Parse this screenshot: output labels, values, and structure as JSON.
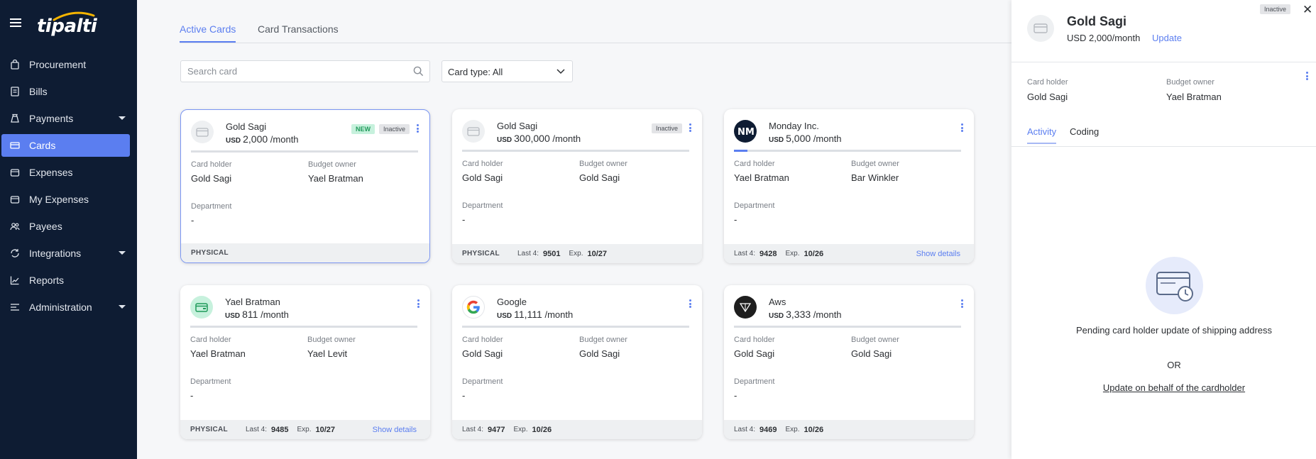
{
  "app": {
    "logo_text": "tipalti",
    "nav": [
      {
        "label": "Procurement",
        "icon": "shopping-bag-icon",
        "active": false,
        "has_caret": false
      },
      {
        "label": "Bills",
        "icon": "document-icon",
        "active": false,
        "has_caret": false
      },
      {
        "label": "Payments",
        "icon": "money-bag-icon",
        "active": false,
        "has_caret": true
      },
      {
        "label": "Cards",
        "icon": "credit-card-icon",
        "active": true,
        "has_caret": false
      },
      {
        "label": "Expenses",
        "icon": "wallet-icon",
        "active": false,
        "has_caret": false
      },
      {
        "label": "My Expenses",
        "icon": "wallet-icon",
        "active": false,
        "has_caret": false
      },
      {
        "label": "Payees",
        "icon": "people-icon",
        "active": false,
        "has_caret": false
      },
      {
        "label": "Integrations",
        "icon": "sync-icon",
        "active": false,
        "has_caret": true
      },
      {
        "label": "Reports",
        "icon": "chart-icon",
        "active": false,
        "has_caret": false
      },
      {
        "label": "Administration",
        "icon": "list-settings-icon",
        "active": false,
        "has_caret": true
      }
    ]
  },
  "main": {
    "tabs": [
      "Active Cards",
      "Card Transactions"
    ],
    "search_placeholder": "Search card",
    "card_type_filter": "Card type: All",
    "labels": {
      "card_holder": "Card holder",
      "budget_owner": "Budget owner",
      "department": "Department",
      "last4": "Last 4:",
      "exp": "Exp.",
      "show_details": "Show details"
    },
    "cards": [
      {
        "name": "Gold Sagi",
        "currency": "USD",
        "amount": "2,000",
        "period": "/month",
        "badges": [
          "NEW",
          "Inactive"
        ],
        "card_holder": "Gold Sagi",
        "budget_owner": "Yael Bratman",
        "department": "-",
        "type": "PHYSICAL",
        "last4": "",
        "exp": "",
        "show_details": false,
        "logo": "card-placeholder",
        "progress": 0,
        "selected": true
      },
      {
        "name": "Gold Sagi",
        "currency": "USD",
        "amount": "300,000",
        "period": "/month",
        "badges": [
          "Inactive"
        ],
        "card_holder": "Gold Sagi",
        "budget_owner": "Gold Sagi",
        "department": "-",
        "type": "PHYSICAL",
        "last4": "9501",
        "exp": "10/27",
        "show_details": false,
        "logo": "card-placeholder",
        "progress": 0,
        "selected": false
      },
      {
        "name": "Monday Inc.",
        "currency": "USD",
        "amount": "5,000",
        "period": "/month",
        "badges": [],
        "card_holder": "Yael Bratman",
        "budget_owner": "Bar Winkler",
        "department": "-",
        "type": "",
        "last4": "9428",
        "exp": "10/26",
        "show_details": true,
        "logo": "monday-logo",
        "progress": 0.06,
        "selected": false
      },
      {
        "name": "Yael Bratman",
        "currency": "USD",
        "amount": "811",
        "period": "/month",
        "badges": [],
        "card_holder": "Yael Bratman",
        "budget_owner": "Yael Levit",
        "department": "-",
        "type": "PHYSICAL",
        "last4": "9485",
        "exp": "10/27",
        "show_details": true,
        "logo": "card-green",
        "progress": 0,
        "selected": false
      },
      {
        "name": "Google",
        "currency": "USD",
        "amount": "11,111",
        "period": "/month",
        "badges": [],
        "card_holder": "Gold Sagi",
        "budget_owner": "Gold Sagi",
        "department": "-",
        "type": "",
        "last4": "9477",
        "exp": "10/26",
        "show_details": false,
        "logo": "google-logo",
        "progress": 0,
        "selected": false
      },
      {
        "name": "Aws",
        "currency": "USD",
        "amount": "3,333",
        "period": "/month",
        "badges": [],
        "card_holder": "Gold Sagi",
        "budget_owner": "Gold Sagi",
        "department": "-",
        "type": "",
        "last4": "9469",
        "exp": "10/26",
        "show_details": false,
        "logo": "aws-logo",
        "progress": 0,
        "selected": false
      }
    ]
  },
  "panel": {
    "badge": "Inactive",
    "name": "Gold Sagi",
    "amount": "USD 2,000/month",
    "update": "Update",
    "card_holder_label": "Card holder",
    "card_holder": "Gold Sagi",
    "budget_owner_label": "Budget owner",
    "budget_owner": "Yael Bratman",
    "tabs": [
      "Activity",
      "Coding"
    ],
    "pending_text": "Pending card holder update of shipping address",
    "or": "OR",
    "link": "Update on behalf of the cardholder"
  },
  "colors": {
    "sidebar": "#0e1c33",
    "accent": "#5b7ef0",
    "badge_new": "#c7f1dd"
  }
}
